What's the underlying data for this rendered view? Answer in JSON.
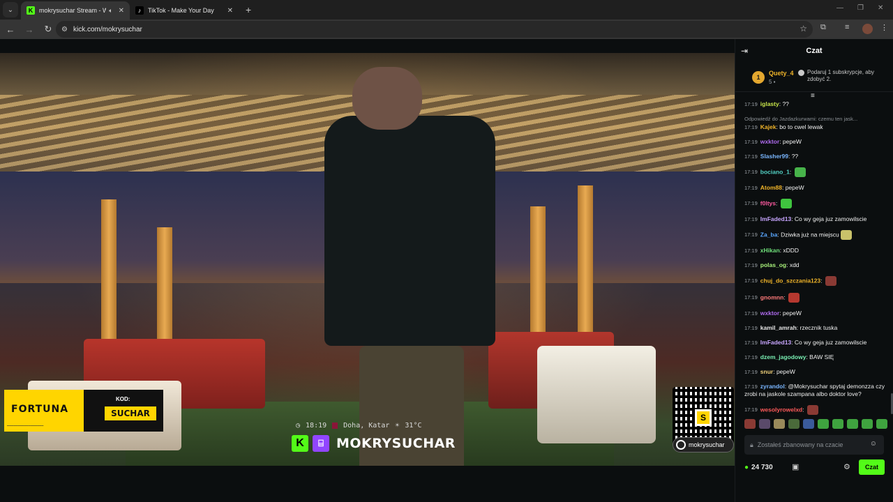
{
  "browser": {
    "tabs": [
      {
        "title": "mokrysuchar Stream - Watc",
        "favicon": "kick-icon",
        "audio": true,
        "active": true
      },
      {
        "title": "TikTok - Make Your Day",
        "favicon": "tiktok-icon",
        "active": false
      }
    ],
    "url": "kick.com/mokrysuchar"
  },
  "stream": {
    "sponsor": {
      "brand": "FORTUNA",
      "code_label": "KOD:",
      "code": "SUCHAR"
    },
    "time": "18:19",
    "location": "Doha, Katar",
    "temperature": "31°C",
    "streamer_name": "MOKRYSUCHAR",
    "social_handle": "mokrysuchar",
    "qr_letter": "S"
  },
  "chat": {
    "title": "Czat",
    "gift": {
      "rank": "1",
      "user": "Quety_4",
      "count": "5",
      "text": "Podaruj 1 subskrypcje, aby zdobyć 2."
    },
    "messages": [
      {
        "time": "17:19",
        "user": "iglasty",
        "color": "#c6e34a",
        "text": "??"
      },
      {
        "reply": "Odpowiedź do Jazdazkurwami: czemu ten jask...",
        "time": "17:19",
        "user": "Kajek",
        "color": "#f0b429",
        "text": "bo to cwel lewak"
      },
      {
        "time": "17:19",
        "user": "wxktor",
        "color": "#b06cf0",
        "text": "pepeW"
      },
      {
        "time": "17:19",
        "user": "Slasher99",
        "color": "#7ab6ff",
        "text": "??"
      },
      {
        "time": "17:19",
        "user": "bociano_1",
        "color": "#53d3c6",
        "text": "",
        "emote": "#47b34a"
      },
      {
        "time": "17:19",
        "user": "Atom88",
        "color": "#f0b429",
        "text": "pepeW"
      },
      {
        "time": "17:19",
        "user": "f0ltys",
        "color": "#ff5aa0",
        "text": "",
        "emote": "#3fc43f"
      },
      {
        "time": "17:19",
        "user": "ImFaded13",
        "color": "#c7a5ff",
        "text": "Co wy geja juz zamowilscie"
      },
      {
        "time": "17:19",
        "user": "Za_ba",
        "color": "#5aa7ff",
        "text": "Dziwka już na miejscu",
        "emote": "#c9c26a"
      },
      {
        "time": "17:19",
        "user": "xHikan",
        "color": "#6fe07a",
        "text": "xDDD"
      },
      {
        "time": "17:19",
        "user": "polas_og",
        "color": "#a8f07a",
        "text": "xdd"
      },
      {
        "time": "17:19",
        "user": "chuj_do_szczania123",
        "color": "#f0b429",
        "text": "",
        "emote": "#8a3a34"
      },
      {
        "time": "17:19",
        "user": "gnomnn",
        "color": "#ff7a7a",
        "text": "",
        "emote": "#b5382f"
      },
      {
        "time": "17:19",
        "user": "wxktor",
        "color": "#b06cf0",
        "text": "pepeW"
      },
      {
        "time": "17:19",
        "user": "kamil_amrah",
        "color": "#e6e6e6",
        "text": "rzecznik tuska"
      },
      {
        "time": "17:19",
        "user": "ImFaded13",
        "color": "#c7a5ff",
        "text": "Co wy geja juz zamowilscie"
      },
      {
        "time": "17:19",
        "user": "dzem_jagodowy",
        "color": "#7af0b4",
        "text": "BAW SIĘ"
      },
      {
        "time": "17:19",
        "user": "snur",
        "color": "#f0d07a",
        "text": "pepeW"
      },
      {
        "time": "17:19",
        "user": "zyrandol",
        "color": "#7ab6ff",
        "text": "@Mokrysuchar spytaj demonzza czy zrobi na jaskole szampana albo doktor love?"
      },
      {
        "time": "17:19",
        "user": "wesolyrowelxd",
        "color": "#ff5a5a",
        "text": "",
        "emote": "#8a3a34"
      }
    ],
    "emote_bar": [
      "#8a3a34",
      "#5a4a6a",
      "#9a8a5a",
      "#4a6a3a",
      "#3a5a9a",
      "#3fa33f",
      "#3fa33f",
      "#3fa33f",
      "#3fa33f",
      "#3fa33f"
    ],
    "input_placeholder": "Zostałeś zbanowany na czacie",
    "points": "24 730",
    "send_label": "Czat"
  }
}
